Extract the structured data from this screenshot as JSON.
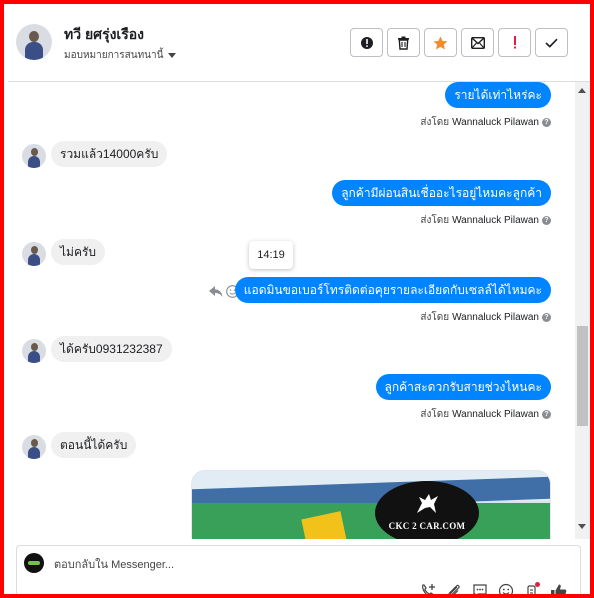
{
  "colors": {
    "frame": "#ff0000",
    "accent_blue": "#0084ff",
    "incoming_bubble": "#f0f0f0",
    "star": "#f28c28",
    "alert_red": "#e41e3f"
  },
  "header": {
    "contact_name": "ทวี ยศรุ่งเรือง",
    "assign_label": "มอบหมายการสนทนานี้",
    "actions": [
      {
        "icon": "alert-circle-icon"
      },
      {
        "icon": "trash-icon"
      },
      {
        "icon": "star-icon"
      },
      {
        "icon": "mark-unread-icon"
      },
      {
        "icon": "exclamation-icon"
      },
      {
        "icon": "check-icon"
      }
    ]
  },
  "messages": [
    {
      "direction": "out",
      "text": "รายได้เท่าไหร่คะ",
      "sent_by_prefix": "ส่งโดย",
      "sender": "Wannaluck Pilawan"
    },
    {
      "direction": "in",
      "text": "รวมแล้ว14000ครับ"
    },
    {
      "direction": "out",
      "text": "ลูกค้ามีผ่อนสินเชื่ออะไรอยู่ไหมคะลูกค้า",
      "sent_by_prefix": "ส่งโดย",
      "sender": "Wannaluck Pilawan"
    },
    {
      "direction": "in",
      "text": "ไม่ครับ"
    },
    {
      "direction": "out",
      "text": "แอดมินขอเบอร์โทรติดต่อคุยรายละเอียดกับเซลล์ได้ไหมคะ",
      "sent_by_prefix": "ส่งโดย",
      "sender": "Wannaluck Pilawan"
    },
    {
      "direction": "in",
      "text": "ได้ครับ0931232387"
    },
    {
      "direction": "out",
      "text": "ลูกค้าสะดวกรับสายช่วงไหนคะ",
      "sent_by_prefix": "ส่งโดย",
      "sender": "Wannaluck Pilawan"
    },
    {
      "direction": "in",
      "text": "ตอนนี้ได้ครับ"
    }
  ],
  "tooltip_time": "14:19",
  "image_attachment": {
    "logo_text": "CKC 2 CAR.COM"
  },
  "composer": {
    "placeholder": "ตอบกลับใน Messenger...",
    "tools": [
      "add-contact-icon",
      "attachment-icon",
      "saved-reply-icon",
      "emoji-icon",
      "bot-icon",
      "like-icon"
    ]
  }
}
